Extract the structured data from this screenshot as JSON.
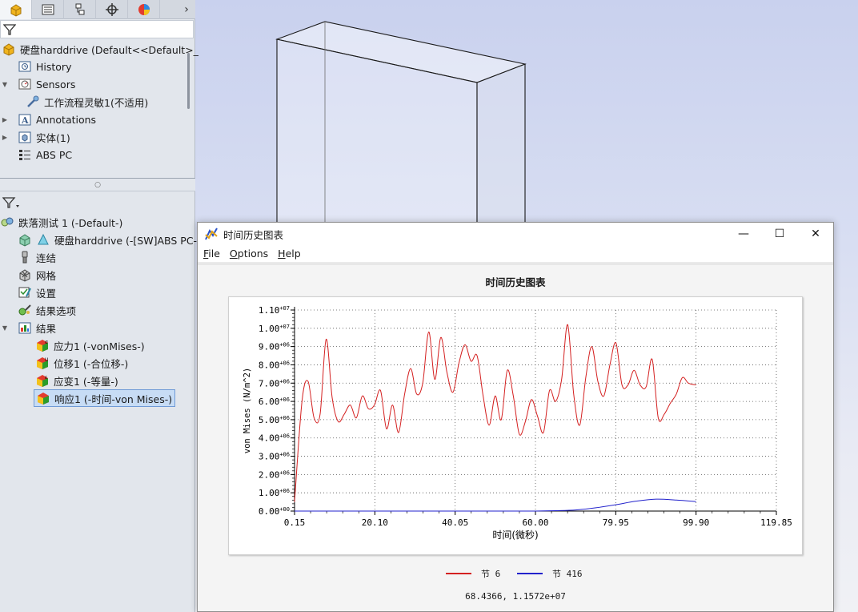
{
  "feature_tree": {
    "tabs": [
      "feature-manager-tab",
      "property-manager-tab",
      "configuration-manager-tab",
      "dimxpert-tab",
      "display-manager-tab"
    ],
    "part_name": "硬盘harddrive  (Default<<Default>_",
    "items": [
      {
        "label": "History",
        "icon": "history-icon"
      },
      {
        "label": "Sensors",
        "icon": "sensors-icon"
      },
      {
        "label": "工作流程灵敏1(不适用)",
        "icon": "workflow-sensor-icon"
      },
      {
        "label": "Annotations",
        "icon": "annotations-icon"
      },
      {
        "label": "实体(1)",
        "icon": "solid-bodies-icon"
      },
      {
        "label": "ABS PC",
        "icon": "material-icon"
      }
    ]
  },
  "study_tree": {
    "study_name": "跌落测试 1 (-Default-)",
    "items": [
      {
        "label": "硬盘harddrive (-[SW]ABS PC-)"
      },
      {
        "label": "连结"
      },
      {
        "label": "网格"
      },
      {
        "label": "设置"
      },
      {
        "label": "结果选项"
      },
      {
        "label": "结果"
      },
      {
        "label": "应力1 (-vonMises-)"
      },
      {
        "label": "位移1 (-合位移-)"
      },
      {
        "label": "应变1 (-等量-)"
      },
      {
        "label": "响应1 (-时间-von Mises-)"
      }
    ]
  },
  "window": {
    "title": "时间历史图表",
    "menu": [
      {
        "label": "File",
        "mnemonic": "F",
        "rest": "ile"
      },
      {
        "label": "Options",
        "mnemonic": "O",
        "rest": "ptions"
      },
      {
        "label": "Help",
        "mnemonic": "H",
        "rest": "elp"
      }
    ],
    "controls": {
      "minimize": "—",
      "maximize": "☐",
      "close": "✕"
    }
  },
  "chart_data": {
    "type": "line",
    "title": "时间历史图表",
    "xlabel": "时间(微秒)",
    "ylabel": "von Mises (N/m^2)",
    "x_ticks": [
      "0.15",
      "20.10",
      "40.05",
      "60.00",
      "79.95",
      "99.90",
      "119.85"
    ],
    "y_ticks": [
      "0.00+00",
      "1.00+06",
      "2.00+06",
      "3.00+06",
      "4.00+06",
      "5.00+06",
      "6.00+06",
      "7.00+06",
      "8.00+06",
      "9.00+06",
      "1.00+07",
      "1.10+07"
    ],
    "y_ticks_display": [
      {
        "mantissa": "0.00",
        "exp": "+00"
      },
      {
        "mantissa": "1.00",
        "exp": "+06"
      },
      {
        "mantissa": "2.00",
        "exp": "+06"
      },
      {
        "mantissa": "3.00",
        "exp": "+06"
      },
      {
        "mantissa": "4.00",
        "exp": "+06"
      },
      {
        "mantissa": "5.00",
        "exp": "+06"
      },
      {
        "mantissa": "6.00",
        "exp": "+06"
      },
      {
        "mantissa": "7.00",
        "exp": "+06"
      },
      {
        "mantissa": "8.00",
        "exp": "+06"
      },
      {
        "mantissa": "9.00",
        "exp": "+06"
      },
      {
        "mantissa": "1.00",
        "exp": "+07"
      },
      {
        "mantissa": "1.10",
        "exp": "+07"
      }
    ],
    "xlim": [
      0.15,
      119.85
    ],
    "ylim": [
      0,
      11000000
    ],
    "grid": true,
    "legend_position": "bottom",
    "series": [
      {
        "name": "节 6",
        "color": "#d42020",
        "x": [
          0.15,
          2,
          3.5,
          5,
          6.5,
          8,
          9.5,
          11,
          12.5,
          14,
          15.5,
          17,
          18.5,
          20,
          21.5,
          23,
          24.5,
          26,
          27.5,
          29,
          30.5,
          32,
          33.5,
          35,
          36.5,
          38,
          39.5,
          41,
          42.5,
          44,
          45.5,
          47,
          48.5,
          50,
          51.5,
          53,
          54.5,
          56,
          57.5,
          59,
          60.5,
          62,
          63.5,
          65,
          66.5,
          68,
          69.5,
          71,
          72.5,
          74,
          75.5,
          77,
          78.5,
          80,
          81.5,
          83,
          84.5,
          86,
          87.5,
          89,
          90.5,
          92,
          93.5,
          95,
          96.5,
          98,
          99.9
        ],
        "y": [
          500000,
          6000000,
          7100000,
          5100000,
          5300000,
          9400000,
          6200000,
          4900000,
          5300000,
          5800000,
          5100000,
          6300000,
          5600000,
          5800000,
          6600000,
          4500000,
          5800000,
          4300000,
          6400000,
          7800000,
          6400000,
          7000000,
          9800000,
          7200000,
          9500000,
          7600000,
          6500000,
          8100000,
          9100000,
          8200000,
          8500000,
          6300000,
          4700000,
          6300000,
          5000000,
          7700000,
          6300000,
          4200000,
          4900000,
          6100000,
          5200000,
          4300000,
          6600000,
          6000000,
          7200000,
          10200000,
          6400000,
          4700000,
          7300000,
          9000000,
          7100000,
          6300000,
          8000000,
          9200000,
          6900000,
          6900000,
          7700000,
          6900000,
          6800000,
          8300000,
          5100000,
          5300000,
          5900000,
          6400000,
          7300000,
          7000000,
          6900000
        ]
      },
      {
        "name": "节 416",
        "color": "#2222cc",
        "x": [
          0.15,
          20,
          40,
          55,
          60,
          65,
          70,
          75,
          80,
          85,
          90,
          95,
          99.9
        ],
        "y": [
          0,
          0,
          0,
          0,
          0,
          20000,
          60000,
          180000,
          350000,
          540000,
          650000,
          600000,
          520000
        ]
      }
    ],
    "status_readout": "68.4366, 1.1572e+07"
  }
}
